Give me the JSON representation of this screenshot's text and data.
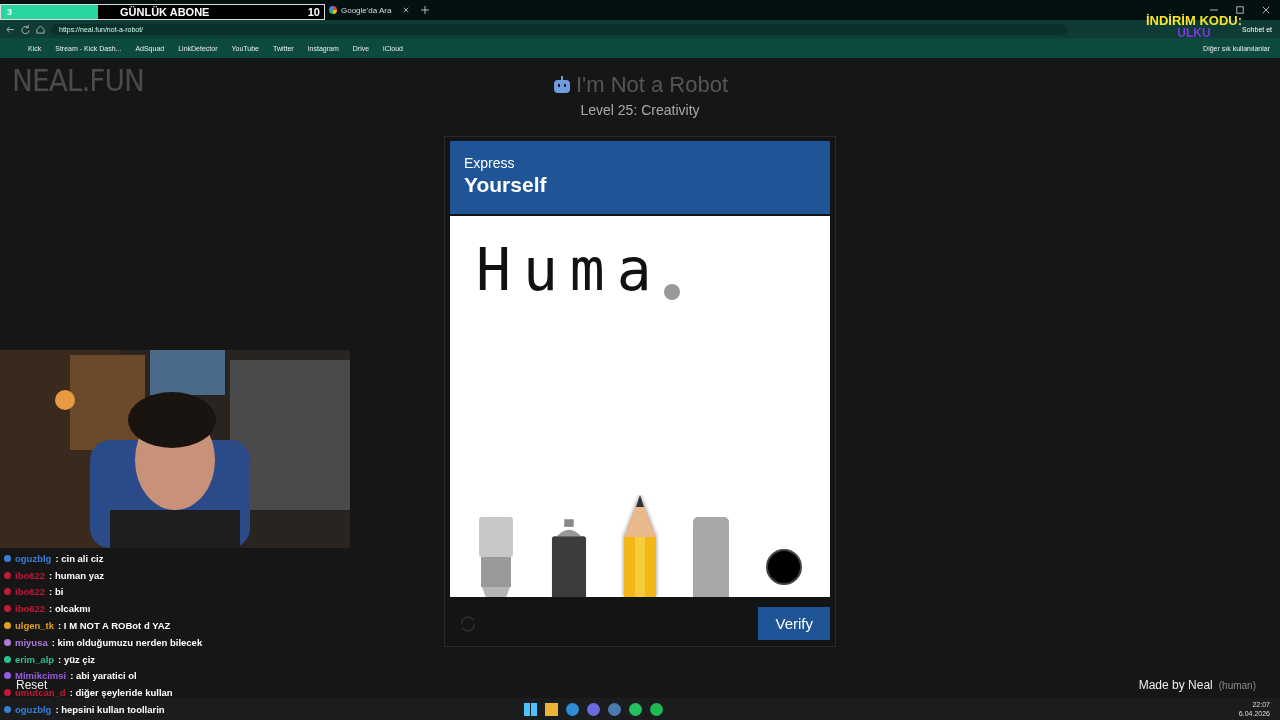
{
  "goal_overlay": {
    "current": "3",
    "label": "GÜNLÜK ABONE",
    "target": "10",
    "level": 0.3
  },
  "tabs": [
    {
      "title": "Google'da Ara",
      "selected": false
    }
  ],
  "address_bar": {
    "url": "https://neal.fun/not-a-robot/"
  },
  "toolbar": {
    "chat_button": "Sohbet et"
  },
  "bookmarks": [
    "Kick",
    "Stream - Kick Dash...",
    "AdSquad",
    "LinkDetector",
    "YouTube",
    "Twitter",
    "Instagram",
    "Drive",
    "iCloud"
  ],
  "other_favorites": "Diğer sık kullanılanlar",
  "promo_overlay": {
    "line_1": "İNDİRİM KODU:",
    "line_2": "ULKU"
  },
  "site_logo": "NEAL.FUN",
  "page": {
    "title": "I'm Not a Robot",
    "subtitle": "Level 25: Creativity"
  },
  "captcha": {
    "prompt_small": "Express",
    "prompt_large": "Yourself",
    "canvas_text": "Huma",
    "tools": [
      {
        "kind": "brush",
        "selected": false
      },
      {
        "kind": "spray",
        "selected": false
      },
      {
        "kind": "pencil",
        "selected": true
      },
      {
        "kind": "eraser",
        "selected": false
      },
      {
        "kind": "color",
        "color": "#000000"
      }
    ],
    "verify_button": "Verify"
  },
  "footer": {
    "credit": "Made by Neal",
    "note": "(human)"
  },
  "chat": [
    {
      "user": "oguzblg",
      "color": "#3a7fd5",
      "text": ": cin ali ciz"
    },
    {
      "user": "ibo622",
      "color": "#c2183a",
      "text": ": human yaz"
    },
    {
      "user": "ibo622",
      "color": "#c2183a",
      "text": ": bi"
    },
    {
      "user": "ibo622",
      "color": "#c2183a",
      "text": ": olcakmı"
    },
    {
      "user": "ulgen_tk",
      "color": "#e0a020",
      "text": ": I M NOT A ROBot d YAZ"
    },
    {
      "user": "miyusa",
      "color": "#b07ad8",
      "text": ": kim olduğumuzu nerden bilecek"
    },
    {
      "user": "erim_alp",
      "color": "#2ec08a",
      "text": ": yüz çiz"
    },
    {
      "user": "Mimikcimsi",
      "color": "#9a5ae0",
      "text": ": abi yaratici ol"
    },
    {
      "user": "umutcan_d",
      "color": "#c2183a",
      "text": ": diğer şeyleride kullan"
    },
    {
      "user": "oguzblg",
      "color": "#3a7fd5",
      "text": ": hepsini kullan toollarin"
    }
  ],
  "reset_label": "Reset",
  "taskbar": {
    "time": "22:07",
    "date": "6.04.2026"
  }
}
